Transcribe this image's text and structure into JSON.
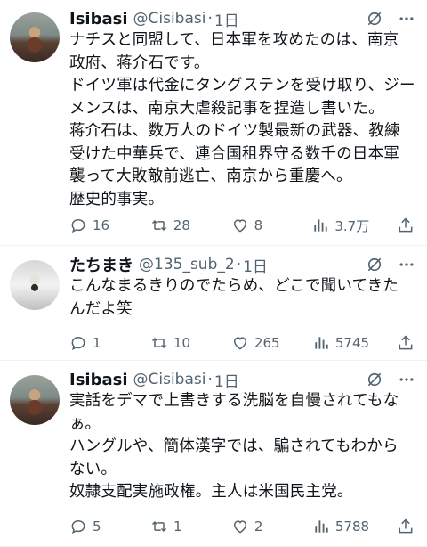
{
  "tweets": [
    {
      "name": "Isibasi",
      "handle": "@Cisibasi",
      "dot": "·",
      "time": "1日",
      "lines": [
        "ナチスと同盟して、日本軍を攻めたのは、南京",
        "政府、蒋介石です。",
        "ドイツ軍は代金にタングステンを受け取り、ジー",
        "メンスは、南京大虐殺記事を捏造し書いた。",
        "蒋介石は、数万人のドイツ製最新の武器、教練",
        "受けた中華兵で、連合国租界守る数千の日本軍",
        "襲って大敗敵前逃亡、南京から重慶へ。",
        "歴史的事実。"
      ],
      "replies": "16",
      "retweets": "28",
      "likes": "8",
      "views": "3.7万"
    },
    {
      "name": "たちまき",
      "handle": "@135_sub_2",
      "dot": "·",
      "time": "1日",
      "lines": [
        "こんなまるきりのでたらめ、どこで聞いてきた",
        "んだよ笑"
      ],
      "replies": "1",
      "retweets": "10",
      "likes": "265",
      "views": "5745"
    },
    {
      "name": "Isibasi",
      "handle": "@Cisibasi",
      "dot": "·",
      "time": "1日",
      "lines": [
        "実話をデマで上書きする洗脳を自慢されてもな",
        "ぁ。",
        "ハングルや、簡体漢字では、騙されてもわから",
        "ない。",
        "奴隷支配実施政権。主人は米国民主党。"
      ],
      "replies": "5",
      "retweets": "1",
      "likes": "2",
      "views": "5788"
    }
  ],
  "icons": {
    "grok": "grok-icon",
    "more": "more-icon",
    "reply": "reply-icon",
    "retweet": "retweet-icon",
    "like": "like-icon",
    "views": "views-icon",
    "share": "share-icon"
  },
  "colors": {
    "text": "#0f1419",
    "secondary": "#536471",
    "divider": "#eff3f4"
  }
}
